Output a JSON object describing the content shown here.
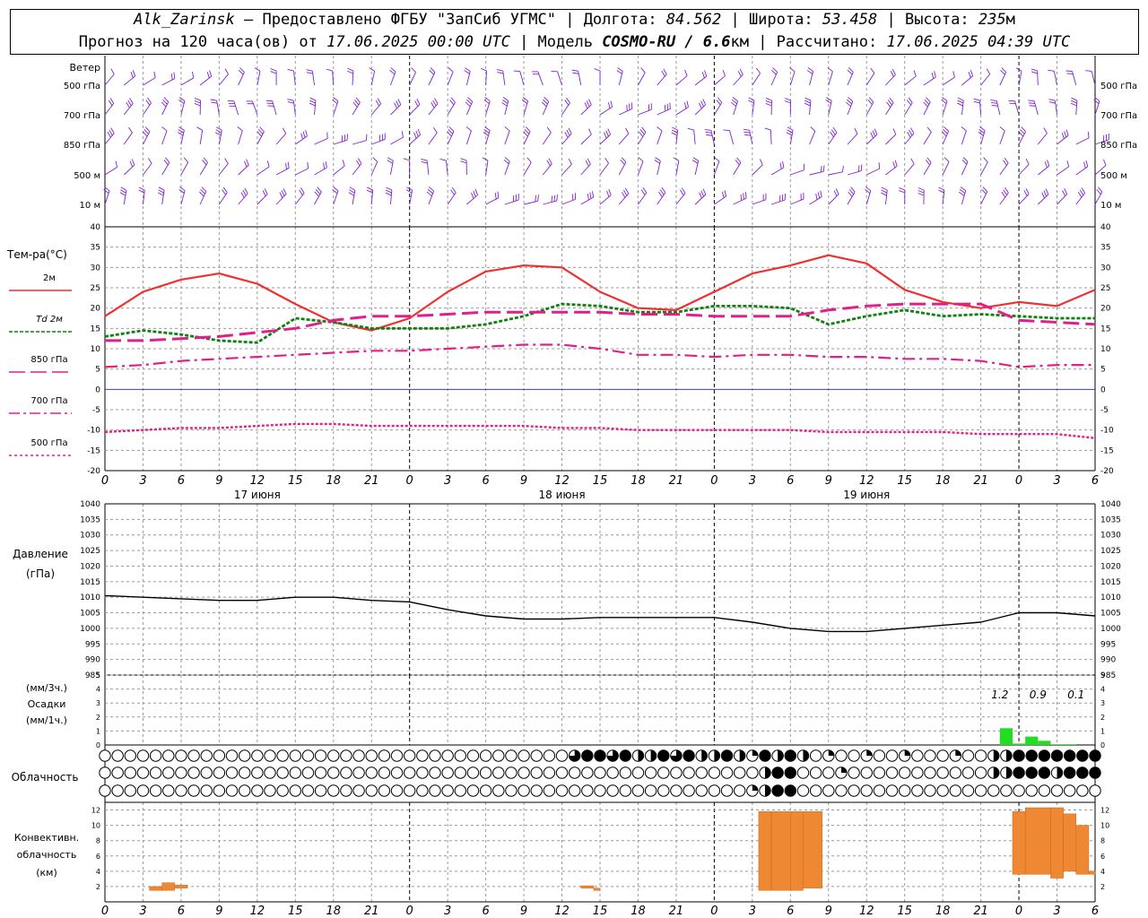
{
  "header": {
    "station": "Alk_Zarinsk",
    "provider": " — Предоставлено ФГБУ \"ЗапСиб УГМС\" | Долгота: ",
    "lon": "84.562",
    "lat_label": " | Широта: ",
    "lat": "53.458",
    "alt_label": " | Высота: ",
    "alt": "235",
    "alt_unit": "м",
    "forecast_label": "Прогноз на 120 часа(ов) от ",
    "forecast_from": "17.06.2025 00:00 UTC",
    "model_label": " | Модель ",
    "model": "COSMO-RU / 6.6",
    "model_unit": "км",
    "calc_label": " | Рассчитано: ",
    "calc_time": "17.06.2025 04:39 UTC"
  },
  "x_axis": {
    "ticks": [
      "0",
      "3",
      "6",
      "9",
      "12",
      "15",
      "18",
      "21",
      "0",
      "3",
      "6",
      "9",
      "12",
      "15",
      "18",
      "21",
      "0",
      "3",
      "6",
      "9",
      "12",
      "15",
      "18",
      "21",
      "0",
      "3",
      "6"
    ],
    "days": [
      "17 июня",
      "18 июня",
      "19 июня"
    ]
  },
  "panels": {
    "wind": {
      "title": "Ветер",
      "levels": [
        "500 гПа",
        "700 гПа",
        "850 гПа",
        "500 м",
        "10 м"
      ],
      "color": "#8020d0"
    },
    "temp": {
      "title": "Тем-ра(°C)",
      "yticks": [
        40,
        35,
        30,
        25,
        20,
        15,
        10,
        5,
        0,
        -5,
        -10,
        -15,
        -20
      ],
      "legend": [
        {
          "label": "2м",
          "color": "#f03030"
        },
        {
          "label": "Td 2м",
          "color": "#108010"
        },
        {
          "label": "850 гПа",
          "color": "#e0208a"
        },
        {
          "label": "700 гПа",
          "color": "#e0208a"
        },
        {
          "label": "500 гПа",
          "color": "#e0208a"
        }
      ]
    },
    "pressure": {
      "title1": "Давление",
      "title2": "(гПа)",
      "yticks": [
        1040,
        1035,
        1030,
        1025,
        1020,
        1015,
        1010,
        1005,
        1000,
        995,
        990,
        985
      ]
    },
    "precip": {
      "title1": "(мм/3ч.)",
      "title2": "Осадки",
      "title3": "(мм/1ч.)",
      "yticks": [
        5,
        4,
        3,
        2,
        1,
        0
      ],
      "totals": [
        "1.2",
        "0.9",
        "0.1"
      ]
    },
    "cloud": {
      "title": "Облачность"
    },
    "conv": {
      "title1": "Конвективн.",
      "title2": "облачность",
      "title3": "(км)",
      "yticks": [
        12,
        10,
        8,
        6,
        4,
        2
      ]
    }
  },
  "chart_data": [
    {
      "type": "line",
      "title": "Тем-ра(°C)",
      "x_unit": "hours since 17.06.2025 00:00 UTC",
      "ylim": [
        -20,
        40
      ],
      "series": [
        {
          "name": "2м",
          "color": "#f03030",
          "x": [
            0,
            3,
            6,
            9,
            12,
            15,
            18,
            21,
            24,
            27,
            30,
            33,
            36,
            39,
            42,
            45,
            48,
            51,
            54,
            57,
            60,
            63,
            66,
            69,
            72,
            75,
            78
          ],
          "values": [
            18,
            24,
            27,
            28.5,
            26,
            21,
            16.5,
            14.5,
            17.5,
            24,
            29,
            30.5,
            30,
            24,
            20,
            19.5,
            24,
            28.5,
            30.5,
            33,
            31,
            24.5,
            21.5,
            20,
            21.5,
            20.5,
            24.5
          ]
        },
        {
          "name": "Td 2м",
          "color": "#108010",
          "x": [
            0,
            3,
            6,
            9,
            12,
            15,
            18,
            21,
            24,
            27,
            30,
            33,
            36,
            39,
            42,
            45,
            48,
            51,
            54,
            57,
            60,
            63,
            66,
            69,
            72,
            75,
            78
          ],
          "values": [
            13,
            14.5,
            13.5,
            12,
            11.5,
            17.5,
            16.5,
            15,
            15,
            15,
            16,
            18,
            21,
            20.5,
            19,
            19,
            20.5,
            20.5,
            20,
            16,
            18,
            19.5,
            18,
            18.5,
            18,
            17.5,
            17.5
          ]
        },
        {
          "name": "850 гПа",
          "color": "#e0208a",
          "x": [
            0,
            3,
            6,
            9,
            12,
            15,
            18,
            21,
            24,
            27,
            30,
            33,
            36,
            39,
            42,
            45,
            48,
            51,
            54,
            57,
            60,
            63,
            66,
            69,
            72,
            75,
            78
          ],
          "values": [
            12,
            12,
            12.5,
            13,
            14,
            15,
            17,
            18,
            18,
            18.5,
            19,
            19,
            19,
            19,
            18.5,
            18.5,
            18,
            18,
            18,
            19.5,
            20.5,
            21,
            21,
            21,
            17,
            16.5,
            16
          ]
        },
        {
          "name": "700 гПа",
          "color": "#e0208a",
          "x": [
            0,
            3,
            6,
            9,
            12,
            15,
            18,
            21,
            24,
            27,
            30,
            33,
            36,
            39,
            42,
            45,
            48,
            51,
            54,
            57,
            60,
            63,
            66,
            69,
            72,
            75,
            78
          ],
          "values": [
            5.5,
            6,
            7,
            7.5,
            8,
            8.5,
            9,
            9.5,
            9.5,
            10,
            10.5,
            11,
            11,
            10,
            8.5,
            8.5,
            8,
            8.5,
            8.5,
            8,
            8,
            7.5,
            7.5,
            7,
            5.5,
            6,
            6
          ]
        },
        {
          "name": "500 гПа",
          "color": "#e0208a",
          "x": [
            0,
            3,
            6,
            9,
            12,
            15,
            18,
            21,
            24,
            27,
            30,
            33,
            36,
            39,
            42,
            45,
            48,
            51,
            54,
            57,
            60,
            63,
            66,
            69,
            72,
            75,
            78
          ],
          "values": [
            -10.5,
            -10,
            -9.5,
            -9.5,
            -9,
            -8.5,
            -8.5,
            -9,
            -9,
            -9,
            -9,
            -9,
            -9.5,
            -9.5,
            -10,
            -10,
            -10,
            -10,
            -10,
            -10.5,
            -10.5,
            -10.5,
            -10.5,
            -11,
            -11,
            -11,
            -12
          ]
        }
      ]
    },
    {
      "type": "line",
      "title": "Давление",
      "x_unit": "hours since 17.06.2025 00:00 UTC",
      "ylim": [
        985,
        1040
      ],
      "series": [
        {
          "name": "",
          "x": [
            0,
            3,
            6,
            9,
            12,
            15,
            18,
            21,
            24,
            27,
            30,
            33,
            36,
            39,
            42,
            45,
            48,
            51,
            54,
            57,
            60,
            63,
            66,
            69,
            72,
            75,
            78
          ],
          "values": [
            1010.5,
            1010,
            1009.5,
            1009,
            1009,
            1010,
            1010,
            1009,
            1008.5,
            1006,
            1004,
            1003,
            1003,
            1003.5,
            1003.5,
            1003.5,
            1003.5,
            1002,
            1000,
            999,
            999,
            1000,
            1001,
            1002,
            1005,
            1005,
            1004
          ]
        }
      ]
    },
    {
      "type": "bar",
      "title": "Осадки",
      "x_unit": "hours since 17.06.2025 00:00 UTC",
      "ylim": [
        0,
        5
      ],
      "x": [
        71,
        72,
        73,
        74,
        75,
        76
      ],
      "values": [
        1.2,
        0.1,
        0.6,
        0.3,
        0.05,
        0.05
      ]
    },
    {
      "type": "bar",
      "title": "Конвективн. облачность",
      "x_unit": "hours since 17.06.2025 00:00 UTC",
      "ylim": [
        0,
        13
      ],
      "bars": [
        {
          "x0": 3.5,
          "x1": 4.5,
          "base": 1.5,
          "top": 2
        },
        {
          "x0": 4.5,
          "x1": 5.5,
          "base": 1.5,
          "top": 2.5
        },
        {
          "x0": 5.5,
          "x1": 6.5,
          "base": 1.8,
          "top": 2.2
        },
        {
          "x0": 37.5,
          "x1": 38.5,
          "base": 1.8,
          "top": 2.1
        },
        {
          "x0": 38.5,
          "x1": 39,
          "base": 1.5,
          "top": 1.8
        },
        {
          "x0": 51.5,
          "x1": 52.5,
          "base": 1.5,
          "top": 11.8
        },
        {
          "x0": 52.5,
          "x1": 54,
          "base": 1.5,
          "top": 11.8
        },
        {
          "x0": 54,
          "x1": 55,
          "base": 1.5,
          "top": 11.8
        },
        {
          "x0": 55,
          "x1": 56.5,
          "base": 1.8,
          "top": 11.8
        },
        {
          "x0": 71.5,
          "x1": 72.5,
          "base": 3.6,
          "top": 11.8
        },
        {
          "x0": 72.5,
          "x1": 74.5,
          "base": 3.6,
          "top": 12.3
        },
        {
          "x0": 74.5,
          "x1": 75.5,
          "base": 3.1,
          "top": 12.3
        },
        {
          "x0": 75.5,
          "x1": 76.5,
          "base": 4,
          "top": 11.5
        },
        {
          "x0": 76.5,
          "x1": 77.5,
          "base": 3.6,
          "top": 10
        },
        {
          "x0": 77.5,
          "x1": 78,
          "base": 3.6,
          "top": 4
        }
      ]
    },
    {
      "type": "table",
      "title": "Облачность",
      "rows": [
        "upper",
        "middle",
        "lower"
      ],
      "columns_x_hours_from": 0,
      "columns_x_hours_to": 78,
      "cover_fraction": {
        "upper": {
          "37": 0.75,
          "38": 1,
          "39": 1,
          "40": 0.75,
          "41": 1,
          "42": 0.5,
          "43": 0.5,
          "44": 1,
          "45": 0.75,
          "46": 1,
          "47": 0.5,
          "48": 0.5,
          "49": 1,
          "50": 0.5,
          "51": 0.25,
          "52": 1,
          "53": 0.5,
          "54": 1,
          "55": 0.5,
          "57": 0.25,
          "60": 0.25,
          "63": 0.25,
          "67": 0.25,
          "70": 0.5,
          "71": 0.5,
          "72": 1,
          "73": 1,
          "74": 1,
          "75": 1,
          "76": 1,
          "77": 1,
          "78": 1
        },
        "middle": {
          "52": 0.5,
          "53": 1,
          "54": 1,
          "58": 0.25,
          "70": 0.5,
          "71": 0.5,
          "72": 1,
          "73": 1,
          "74": 1,
          "75": 0.5,
          "76": 1,
          "77": 1,
          "78": 1
        },
        "lower": {
          "51": 0.25,
          "52": 0.5,
          "53": 1,
          "54": 1
        }
      }
    }
  ]
}
